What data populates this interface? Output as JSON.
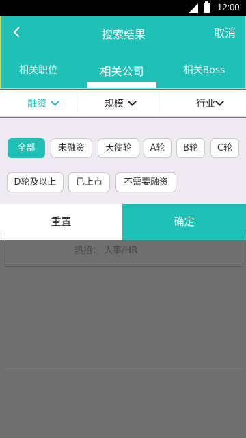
{
  "status_bar": {
    "time": "12:00"
  },
  "header": {
    "title": "搜索结果",
    "cancel_label": "取消",
    "tabs": [
      {
        "label": "相关职位"
      },
      {
        "label": "相关公司"
      },
      {
        "label": "相关Boss"
      }
    ]
  },
  "filters": [
    {
      "label": "融资"
    },
    {
      "label": "规模"
    },
    {
      "label": "行业"
    }
  ],
  "funding_options": [
    {
      "label": "全部"
    },
    {
      "label": "未融资"
    },
    {
      "label": "天使轮"
    },
    {
      "label": "A轮"
    },
    {
      "label": "B轮"
    },
    {
      "label": "C轮"
    },
    {
      "label": "D轮及以上"
    },
    {
      "label": "已上市"
    },
    {
      "label": "不需要融资"
    }
  ],
  "actions": {
    "reset_label": "重置",
    "confirm_label": "确定"
  },
  "background": {
    "hot_jobs": "热招： 人事/HR"
  },
  "colors": {
    "accent": "#1fc0b6",
    "panel_bg": "#efeaf2",
    "overlay": "#6f6f6f"
  }
}
